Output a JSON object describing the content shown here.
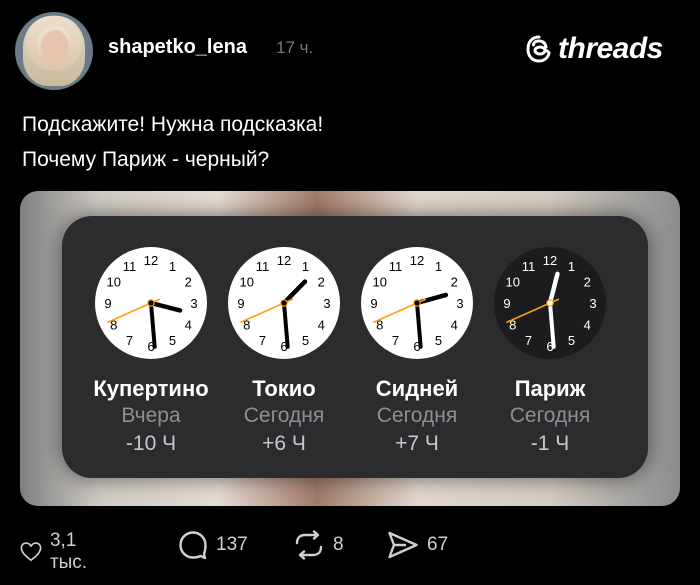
{
  "post": {
    "username": "shapetko_lena",
    "time": "17 ч.",
    "text_line1": "Подскажите! Нужна подсказка!",
    "text_line2": "Почему Париж - черный?"
  },
  "brand": {
    "logo_text": "threads"
  },
  "clocks": [
    {
      "city": "Купертино",
      "day": "Вчера",
      "offset": "-10 Ч",
      "theme": "light",
      "hour": 3.48,
      "minute": 29.2,
      "second": 41
    },
    {
      "city": "Токио",
      "day": "Сегодня",
      "offset": "+6 Ч",
      "theme": "light",
      "hour": 1.48,
      "minute": 29.2,
      "second": 41
    },
    {
      "city": "Сидней",
      "day": "Сегодня",
      "offset": "+7 Ч",
      "theme": "light",
      "hour": 2.48,
      "minute": 29.2,
      "second": 41
    },
    {
      "city": "Париж",
      "day": "Сегодня",
      "offset": "-1 Ч",
      "theme": "dark",
      "hour": 12.48,
      "minute": 29.2,
      "second": 41
    }
  ],
  "clock_numerals": [
    "12",
    "1",
    "2",
    "3",
    "4",
    "5",
    "6",
    "7",
    "8",
    "9",
    "10",
    "11"
  ],
  "actions": {
    "likes": "3,1 тыс.",
    "comments": "137",
    "reposts": "8",
    "shares": "67"
  },
  "colors": {
    "second_hand": "#ff9f0a",
    "widget_bg": "#2c2c2e",
    "page_bg": "#000000"
  }
}
